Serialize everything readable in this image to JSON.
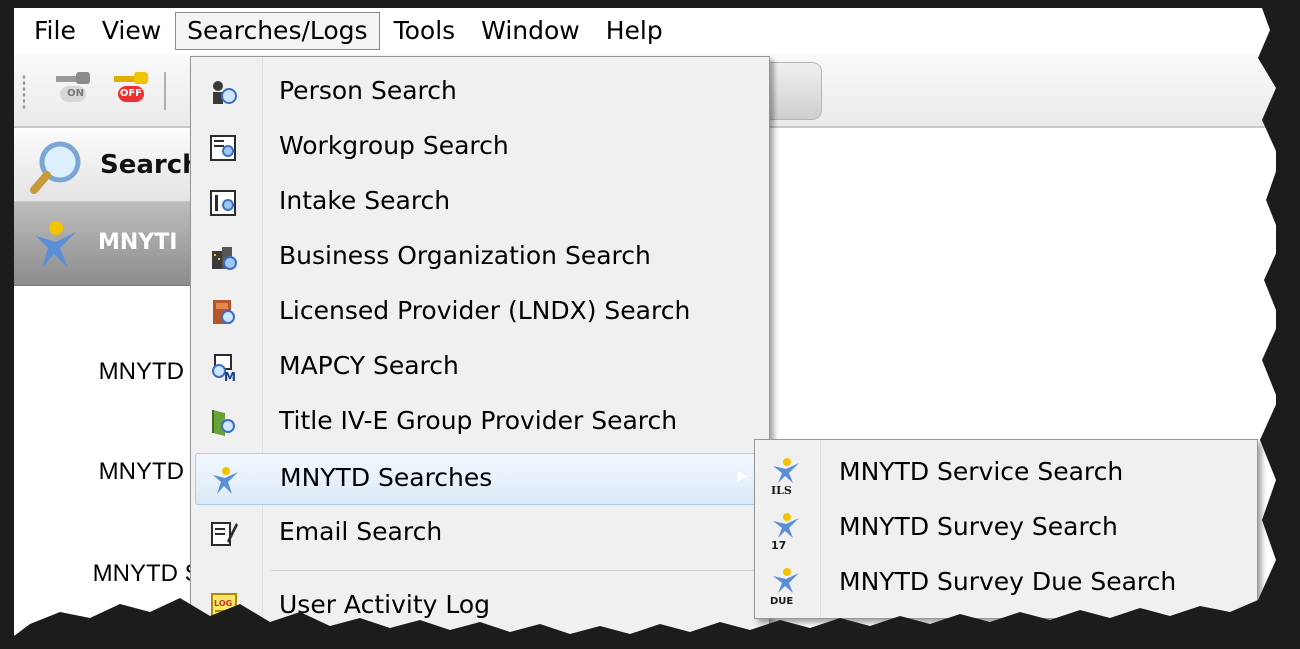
{
  "menubar": {
    "items": [
      {
        "label": "File"
      },
      {
        "label": "View"
      },
      {
        "label": "Searches/Logs"
      },
      {
        "label": "Tools"
      },
      {
        "label": "Window"
      },
      {
        "label": "Help"
      }
    ]
  },
  "toolbar": {
    "key_on_label": "ON",
    "key_off_label": "OFF"
  },
  "left_panel": {
    "search_title": "Search",
    "mnytd_title": "MNYTI",
    "labels": [
      "MNYTD",
      "MNYTD",
      "MNYTD Su"
    ]
  },
  "dropdown": {
    "items": [
      {
        "label": "Person Search",
        "icon": "person-search-icon"
      },
      {
        "label": "Workgroup Search",
        "icon": "workgroup-search-icon"
      },
      {
        "label": "Intake Search",
        "icon": "intake-search-icon"
      },
      {
        "label": "Business Organization Search",
        "icon": "business-org-search-icon"
      },
      {
        "label": "Licensed Provider (LNDX) Search",
        "icon": "licensed-provider-icon"
      },
      {
        "label": "MAPCY Search",
        "icon": "mapcy-search-icon"
      },
      {
        "label": "Title IV-E Group Provider Search",
        "icon": "title-ive-icon"
      },
      {
        "label": "MNYTD Searches",
        "icon": "mnytd-icon"
      },
      {
        "label": "Email Search",
        "icon": "email-search-icon"
      },
      {
        "label": "User Activity Log",
        "icon": "log-icon"
      }
    ]
  },
  "submenu": {
    "items": [
      {
        "label": "MNYTD Service Search",
        "badge": "ILS"
      },
      {
        "label": "MNYTD Survey Search",
        "badge": "17"
      },
      {
        "label": "MNYTD Survey Due Search",
        "badge": "DUE"
      }
    ]
  },
  "colors": {
    "highlight_border": "#a9ccea",
    "menu_bg": "#f0f0f0",
    "icon_blue": "#3b6ec4"
  }
}
